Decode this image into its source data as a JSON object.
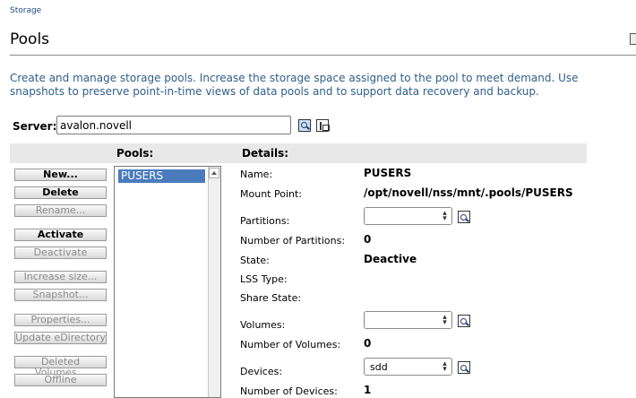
{
  "breadcrumb": "Storage",
  "page_title": "Pools",
  "description": "Create and manage storage pools. Increase the storage space assigned to the pool to meet demand. Use snapshots to preserve point-in-time views of data pools and to support data recovery and backup.",
  "server": {
    "label": "Server:",
    "value": "avalon.novell"
  },
  "headers": {
    "pools": "Pools:",
    "details": "Details:"
  },
  "buttons": {
    "new": "New...",
    "delete": "Delete",
    "rename": "Rename...",
    "activate": "Activate",
    "deactivate": "Deactivate",
    "increase_size": "Increase size...",
    "snapshot": "Snapshot...",
    "properties": "Properties...",
    "update_edirectory": "Update eDirectory",
    "deleted_volumes": "Deleted Volumes...",
    "offline": "Offline"
  },
  "pools": [
    "PUSERS"
  ],
  "details": {
    "name_label": "Name:",
    "name": "PUSERS",
    "mount_label": "Mount Point:",
    "mount": "/opt/novell/nss/mnt/.pools/PUSERS",
    "partitions_label": "Partitions:",
    "partitions_value": "",
    "num_partitions_label": "Number of Partitions:",
    "num_partitions": "0",
    "state_label": "State:",
    "state": "Deactive",
    "lss_label": "LSS Type:",
    "lss": "",
    "share_label": "Share State:",
    "share": "",
    "volumes_label": "Volumes:",
    "volumes_value": "",
    "num_volumes_label": "Number of Volumes:",
    "num_volumes": "0",
    "devices_label": "Devices:",
    "devices_value": "sdd",
    "num_devices_label": "Number of Devices:",
    "num_devices": "1"
  },
  "colors": {
    "selection": "#4a7bbd",
    "link_text": "#2f5f8a",
    "header_bar": "#e8e8e8"
  }
}
